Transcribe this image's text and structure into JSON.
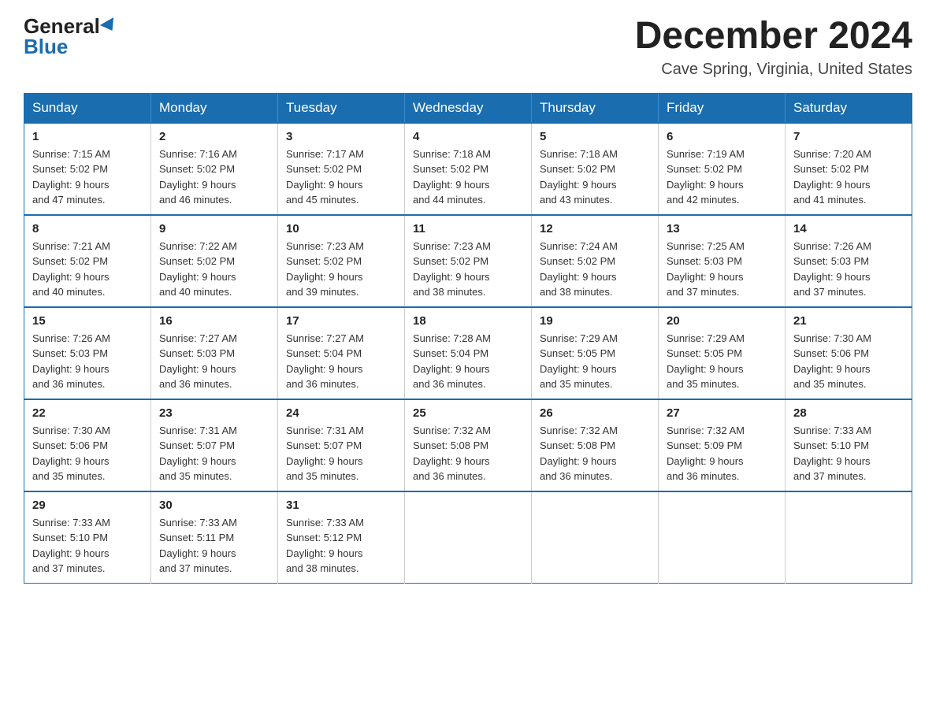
{
  "header": {
    "logo_general": "General",
    "logo_blue": "Blue",
    "month_title": "December 2024",
    "location": "Cave Spring, Virginia, United States"
  },
  "weekdays": [
    "Sunday",
    "Monday",
    "Tuesday",
    "Wednesday",
    "Thursday",
    "Friday",
    "Saturday"
  ],
  "weeks": [
    [
      {
        "day": 1,
        "sunrise": "7:15 AM",
        "sunset": "5:02 PM",
        "daylight": "9 hours and 47 minutes."
      },
      {
        "day": 2,
        "sunrise": "7:16 AM",
        "sunset": "5:02 PM",
        "daylight": "9 hours and 46 minutes."
      },
      {
        "day": 3,
        "sunrise": "7:17 AM",
        "sunset": "5:02 PM",
        "daylight": "9 hours and 45 minutes."
      },
      {
        "day": 4,
        "sunrise": "7:18 AM",
        "sunset": "5:02 PM",
        "daylight": "9 hours and 44 minutes."
      },
      {
        "day": 5,
        "sunrise": "7:18 AM",
        "sunset": "5:02 PM",
        "daylight": "9 hours and 43 minutes."
      },
      {
        "day": 6,
        "sunrise": "7:19 AM",
        "sunset": "5:02 PM",
        "daylight": "9 hours and 42 minutes."
      },
      {
        "day": 7,
        "sunrise": "7:20 AM",
        "sunset": "5:02 PM",
        "daylight": "9 hours and 41 minutes."
      }
    ],
    [
      {
        "day": 8,
        "sunrise": "7:21 AM",
        "sunset": "5:02 PM",
        "daylight": "9 hours and 40 minutes."
      },
      {
        "day": 9,
        "sunrise": "7:22 AM",
        "sunset": "5:02 PM",
        "daylight": "9 hours and 40 minutes."
      },
      {
        "day": 10,
        "sunrise": "7:23 AM",
        "sunset": "5:02 PM",
        "daylight": "9 hours and 39 minutes."
      },
      {
        "day": 11,
        "sunrise": "7:23 AM",
        "sunset": "5:02 PM",
        "daylight": "9 hours and 38 minutes."
      },
      {
        "day": 12,
        "sunrise": "7:24 AM",
        "sunset": "5:02 PM",
        "daylight": "9 hours and 38 minutes."
      },
      {
        "day": 13,
        "sunrise": "7:25 AM",
        "sunset": "5:03 PM",
        "daylight": "9 hours and 37 minutes."
      },
      {
        "day": 14,
        "sunrise": "7:26 AM",
        "sunset": "5:03 PM",
        "daylight": "9 hours and 37 minutes."
      }
    ],
    [
      {
        "day": 15,
        "sunrise": "7:26 AM",
        "sunset": "5:03 PM",
        "daylight": "9 hours and 36 minutes."
      },
      {
        "day": 16,
        "sunrise": "7:27 AM",
        "sunset": "5:03 PM",
        "daylight": "9 hours and 36 minutes."
      },
      {
        "day": 17,
        "sunrise": "7:27 AM",
        "sunset": "5:04 PM",
        "daylight": "9 hours and 36 minutes."
      },
      {
        "day": 18,
        "sunrise": "7:28 AM",
        "sunset": "5:04 PM",
        "daylight": "9 hours and 36 minutes."
      },
      {
        "day": 19,
        "sunrise": "7:29 AM",
        "sunset": "5:05 PM",
        "daylight": "9 hours and 35 minutes."
      },
      {
        "day": 20,
        "sunrise": "7:29 AM",
        "sunset": "5:05 PM",
        "daylight": "9 hours and 35 minutes."
      },
      {
        "day": 21,
        "sunrise": "7:30 AM",
        "sunset": "5:06 PM",
        "daylight": "9 hours and 35 minutes."
      }
    ],
    [
      {
        "day": 22,
        "sunrise": "7:30 AM",
        "sunset": "5:06 PM",
        "daylight": "9 hours and 35 minutes."
      },
      {
        "day": 23,
        "sunrise": "7:31 AM",
        "sunset": "5:07 PM",
        "daylight": "9 hours and 35 minutes."
      },
      {
        "day": 24,
        "sunrise": "7:31 AM",
        "sunset": "5:07 PM",
        "daylight": "9 hours and 35 minutes."
      },
      {
        "day": 25,
        "sunrise": "7:32 AM",
        "sunset": "5:08 PM",
        "daylight": "9 hours and 36 minutes."
      },
      {
        "day": 26,
        "sunrise": "7:32 AM",
        "sunset": "5:08 PM",
        "daylight": "9 hours and 36 minutes."
      },
      {
        "day": 27,
        "sunrise": "7:32 AM",
        "sunset": "5:09 PM",
        "daylight": "9 hours and 36 minutes."
      },
      {
        "day": 28,
        "sunrise": "7:33 AM",
        "sunset": "5:10 PM",
        "daylight": "9 hours and 37 minutes."
      }
    ],
    [
      {
        "day": 29,
        "sunrise": "7:33 AM",
        "sunset": "5:10 PM",
        "daylight": "9 hours and 37 minutes."
      },
      {
        "day": 30,
        "sunrise": "7:33 AM",
        "sunset": "5:11 PM",
        "daylight": "9 hours and 37 minutes."
      },
      {
        "day": 31,
        "sunrise": "7:33 AM",
        "sunset": "5:12 PM",
        "daylight": "9 hours and 38 minutes."
      },
      null,
      null,
      null,
      null
    ]
  ],
  "labels": {
    "sunrise": "Sunrise:",
    "sunset": "Sunset:",
    "daylight": "Daylight:"
  }
}
